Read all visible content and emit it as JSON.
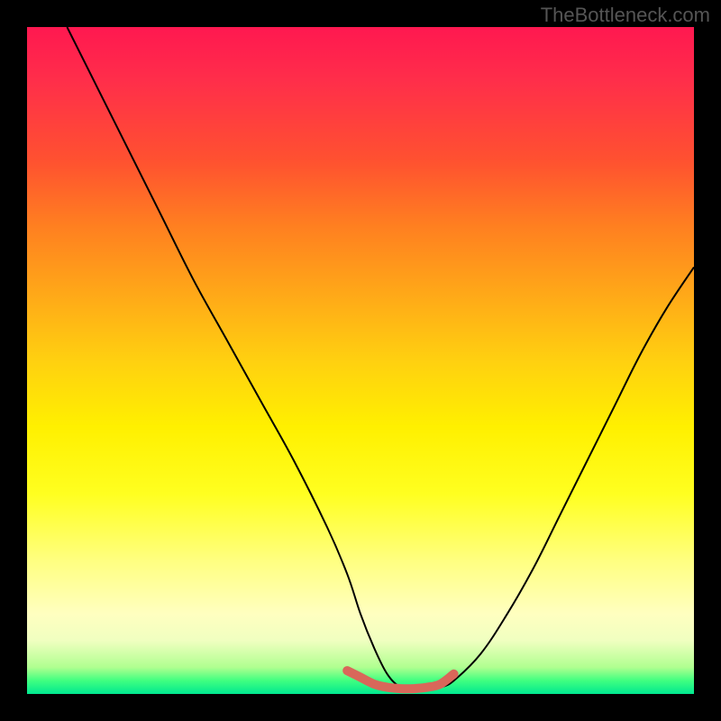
{
  "watermark": "TheBottleneck.com",
  "chart_data": {
    "type": "line",
    "title": "",
    "xlabel": "",
    "ylabel": "",
    "xlim": [
      0,
      100
    ],
    "ylim": [
      0,
      100
    ],
    "series": [
      {
        "name": "main-curve",
        "color": "#000000",
        "x": [
          6,
          10,
          15,
          20,
          25,
          30,
          35,
          40,
          45,
          48,
          50,
          52,
          54,
          56,
          58,
          60,
          62,
          64,
          68,
          72,
          76,
          80,
          84,
          88,
          92,
          96,
          100
        ],
        "y": [
          100,
          92,
          82,
          72,
          62,
          53,
          44,
          35,
          25,
          18,
          12,
          7,
          3,
          1,
          0.5,
          0.5,
          1,
          2,
          6,
          12,
          19,
          27,
          35,
          43,
          51,
          58,
          64
        ]
      },
      {
        "name": "flat-highlight",
        "color": "#d9675a",
        "x": [
          48,
          50,
          52,
          54,
          56,
          58,
          60,
          62,
          64
        ],
        "y": [
          3.5,
          2.5,
          1.5,
          1,
          0.8,
          0.8,
          1,
          1.5,
          3
        ]
      }
    ],
    "gradient_stops": [
      {
        "pos": 0,
        "color": "#ff1850"
      },
      {
        "pos": 50,
        "color": "#ffd010"
      },
      {
        "pos": 100,
        "color": "#00e890"
      }
    ]
  }
}
